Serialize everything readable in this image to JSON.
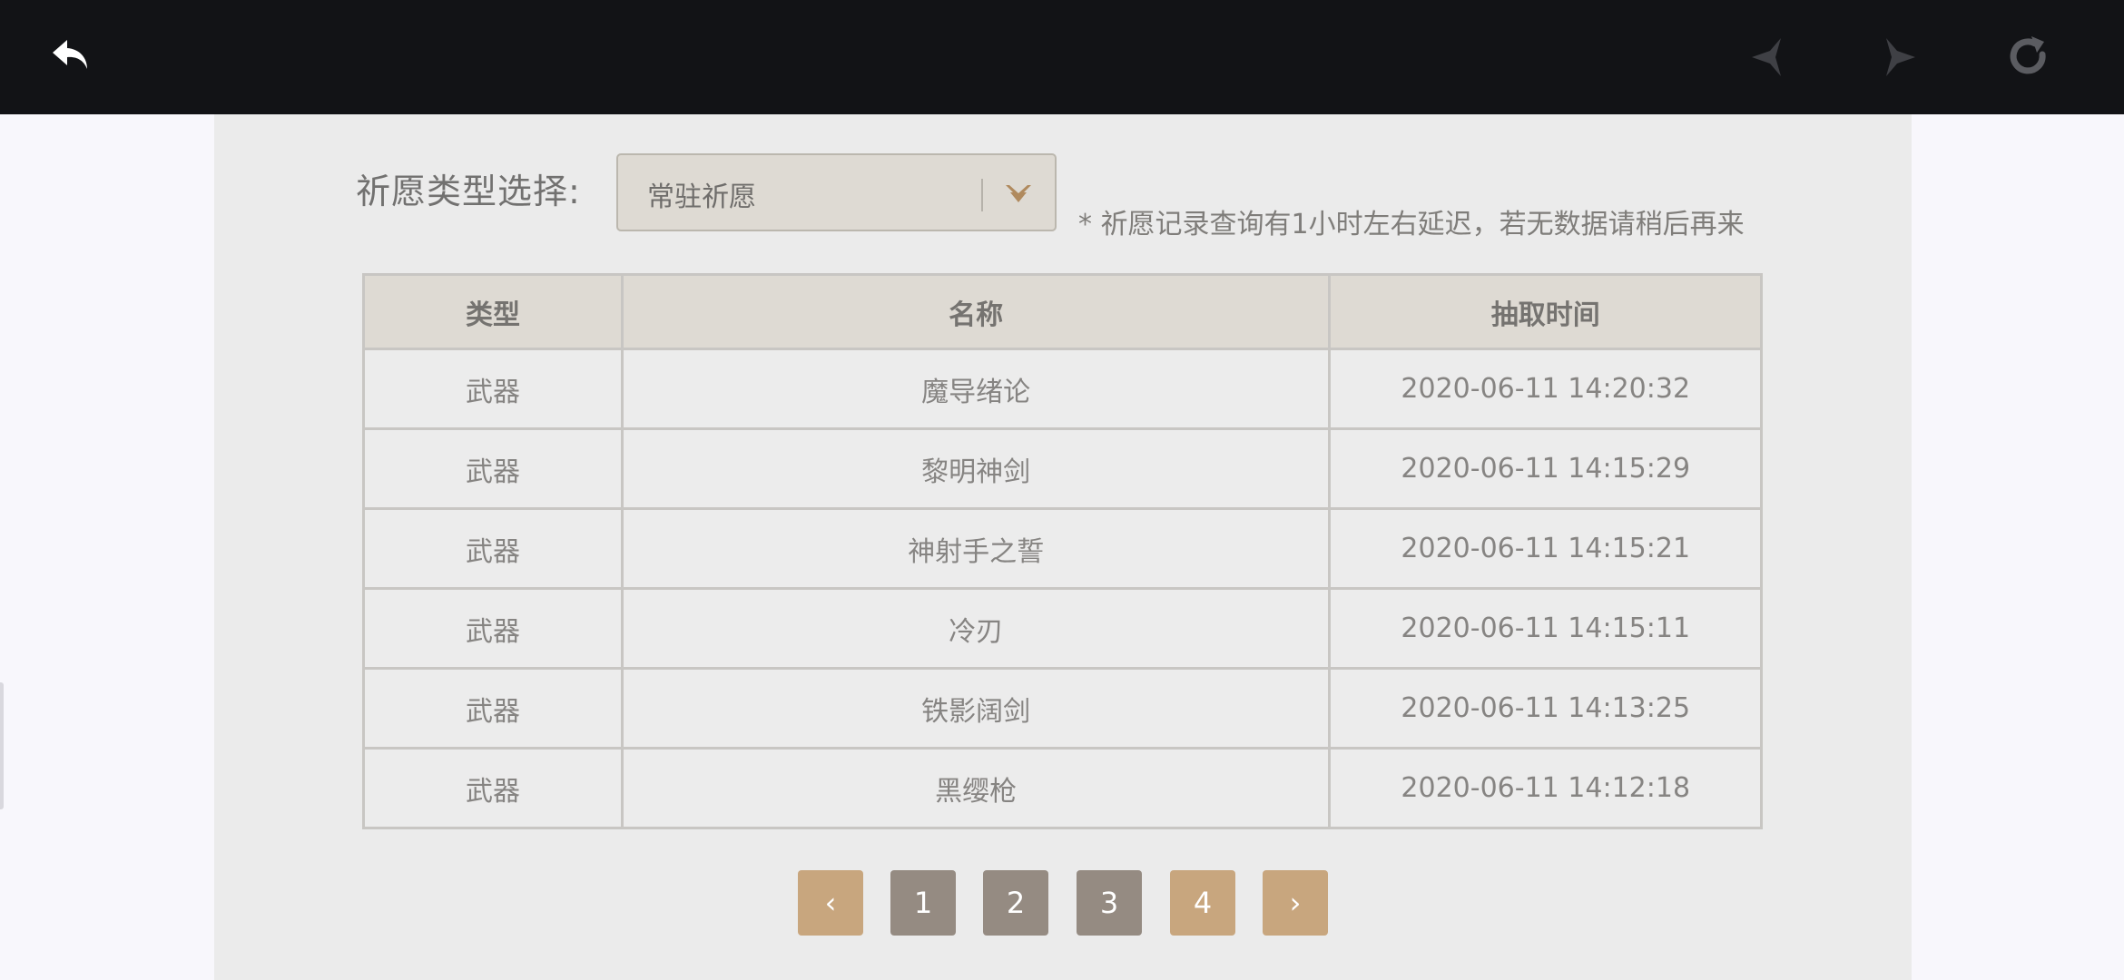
{
  "topbar": {
    "icons": {
      "back": "back-arrow-icon",
      "prev": "star-prev-icon",
      "next": "star-next-icon",
      "refresh": "refresh-icon"
    }
  },
  "filter": {
    "label": "祈愿类型选择:",
    "selected": "常驻祈愿",
    "notice": "* 祈愿记录查询有1小时左右延迟，若无数据请稍后再来"
  },
  "table": {
    "headers": [
      "类型",
      "名称",
      "抽取时间"
    ],
    "rows": [
      {
        "type": "武器",
        "name": "魔导绪论",
        "time": "2020-06-11 14:20:32"
      },
      {
        "type": "武器",
        "name": "黎明神剑",
        "time": "2020-06-11 14:15:29"
      },
      {
        "type": "武器",
        "name": "神射手之誓",
        "time": "2020-06-11 14:15:21"
      },
      {
        "type": "武器",
        "name": "冷刃",
        "time": "2020-06-11 14:15:11"
      },
      {
        "type": "武器",
        "name": "铁影阔剑",
        "time": "2020-06-11 14:13:25"
      },
      {
        "type": "武器",
        "name": "黑缨枪",
        "time": "2020-06-11 14:12:18"
      }
    ]
  },
  "pagination": {
    "prev": "‹",
    "pages": [
      "1",
      "2",
      "3",
      "4"
    ],
    "current": "4",
    "next": "›"
  },
  "colors": {
    "topbar": "#121316",
    "panel": "#ebebeb",
    "accent": "#c8a67e",
    "page_button": "#958b82"
  }
}
